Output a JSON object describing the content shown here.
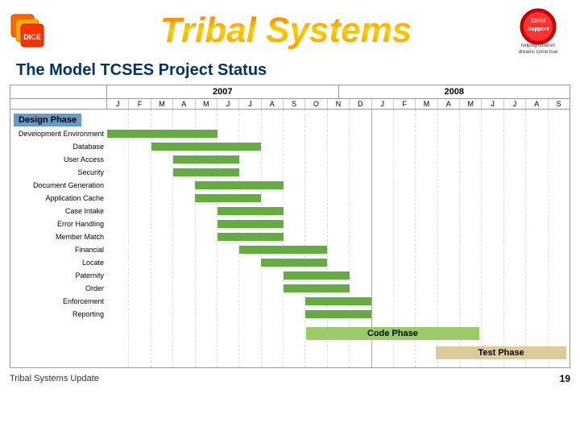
{
  "header": {
    "title": "Tribal Systems",
    "subtitle": "The Model TCSES Project Status",
    "logo_left_text": "DICE",
    "logo_right_text": "Child Support"
  },
  "chart": {
    "years": [
      "2007",
      "2008"
    ],
    "months_2007": [
      "J",
      "F",
      "M",
      "A",
      "M",
      "J",
      "J",
      "A",
      "S",
      "O",
      "N",
      "D"
    ],
    "months_2008": [
      "J",
      "F",
      "M",
      "A",
      "M",
      "J",
      "J",
      "A",
      "S"
    ],
    "design_phase_label": "Design Phase",
    "code_phase_label": "Code Phase",
    "test_phase_label": "Test Phase",
    "tasks": [
      {
        "label": "Development Environment",
        "start": 0,
        "end": 5
      },
      {
        "label": "Database",
        "start": 2,
        "end": 7
      },
      {
        "label": "User Access",
        "start": 3,
        "end": 6
      },
      {
        "label": "Security",
        "start": 3,
        "end": 6
      },
      {
        "label": "Document Generation",
        "start": 4,
        "end": 8
      },
      {
        "label": "Application Cache",
        "start": 4,
        "end": 7
      },
      {
        "label": "Case Intake",
        "start": 5,
        "end": 8
      },
      {
        "label": "Error Handling",
        "start": 5,
        "end": 8
      },
      {
        "label": "Member Match",
        "start": 5,
        "end": 8
      },
      {
        "label": "Financial",
        "start": 6,
        "end": 10
      },
      {
        "label": "Locate",
        "start": 7,
        "end": 10
      },
      {
        "label": "Paternity",
        "start": 8,
        "end": 11
      },
      {
        "label": "Order",
        "start": 8,
        "end": 11
      },
      {
        "label": "Enforcement",
        "start": 9,
        "end": 12
      },
      {
        "label": "Reporting",
        "start": 9,
        "end": 12
      }
    ]
  },
  "footer": {
    "update_text": "Tribal Systems Update",
    "page_number": "19"
  }
}
